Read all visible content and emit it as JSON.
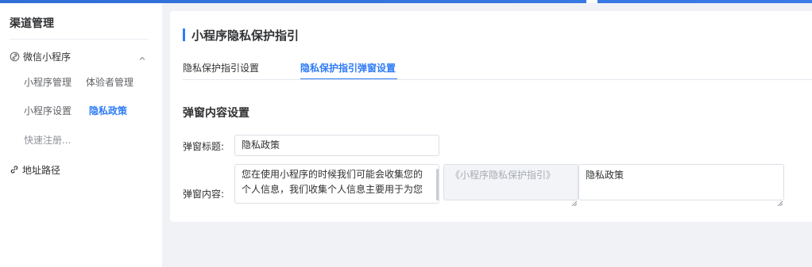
{
  "sidebar": {
    "title": "渠道管理",
    "group": {
      "label": "微信小程序",
      "icon": "link-icon",
      "expanded": true
    },
    "subitems": {
      "mini_program_manage": "小程序管理",
      "tester_manage": "体验者管理",
      "mini_program_settings": "小程序设置",
      "privacy_policy": "隐私政策",
      "quick_register": "快速注册..."
    },
    "address_route": {
      "label": "地址路径",
      "icon": "link-icon"
    }
  },
  "main": {
    "page_title": "小程序隐私保护指引",
    "tabs": [
      {
        "label": "隐私保护指引设置",
        "active": false
      },
      {
        "label": "隐私保护指引弹窗设置",
        "active": true
      }
    ],
    "section_title": "弹窗内容设置",
    "form": {
      "popup_title_label": "弹窗标题:",
      "popup_title_value": "隐私政策",
      "popup_content_label": "弹窗内容:",
      "popup_content_lines": [
        "您在使用小程序的时候我们可能会收集您的",
        "个人信息，我们收集个人信息主要用于为您"
      ],
      "guide_link_text": "《小程序隐私保护指引》",
      "policy_text": "隐私政策"
    }
  },
  "colors": {
    "accent": "#2f7cf6",
    "text": "#303133",
    "muted": "#909399",
    "background": "#f0f2f5"
  }
}
